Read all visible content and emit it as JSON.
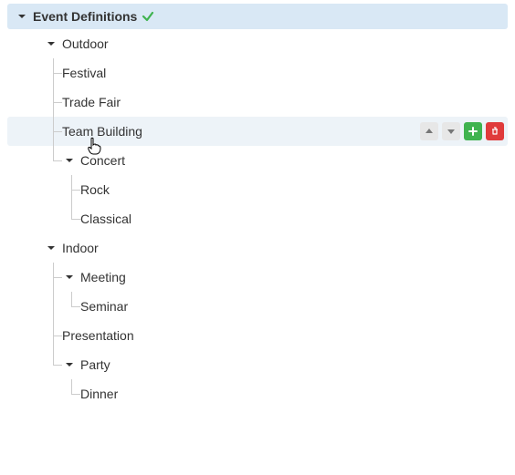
{
  "root": {
    "label": "Event Definitions"
  },
  "outdoor": {
    "label": "Outdoor",
    "children": {
      "festival": "Festival",
      "trade_fair": "Trade Fair",
      "team_building": "Team Building",
      "concert": {
        "label": "Concert",
        "children": {
          "rock": "Rock",
          "classical": "Classical"
        }
      }
    }
  },
  "indoor": {
    "label": "Indoor",
    "children": {
      "meeting": {
        "label": "Meeting",
        "children": {
          "seminar": "Seminar"
        }
      },
      "presentation": "Presentation",
      "party": {
        "label": "Party",
        "children": {
          "dinner": "Dinner"
        }
      }
    }
  },
  "icons": {
    "check": "check-icon",
    "move_up": "arrow-up-icon",
    "move_down": "arrow-down-icon",
    "add": "plus-icon",
    "delete": "trash-icon"
  },
  "colors": {
    "root_bg": "#d9e8f5",
    "hover_bg": "#edf3f8",
    "check": "#3fb34f",
    "btn_gray": "#e7e7e7",
    "btn_green": "#3fb34f",
    "btn_red": "#e03b3b",
    "tree_line": "#cccccc"
  }
}
